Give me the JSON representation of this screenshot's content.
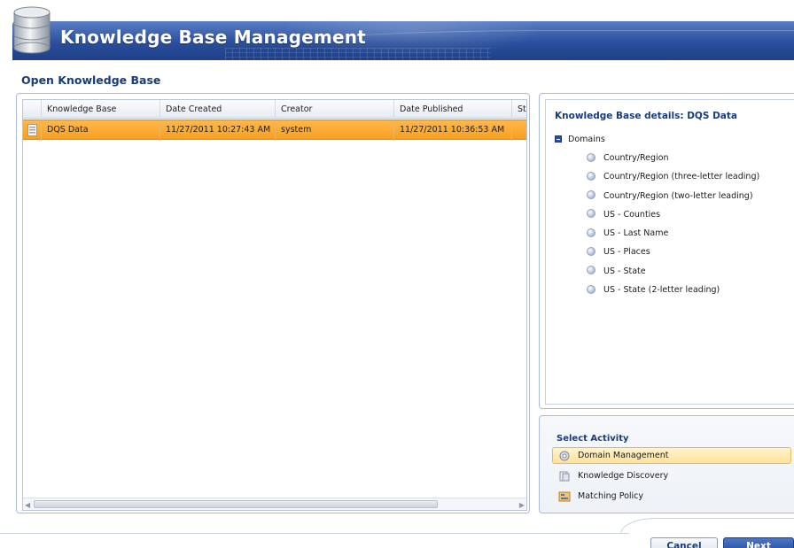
{
  "banner": {
    "title": "Knowledge Base Management"
  },
  "page": {
    "title": "Open Knowledge Base"
  },
  "grid": {
    "columns": [
      "Knowledge Base",
      "Date Created",
      "Creator",
      "Date Published",
      "Sta"
    ],
    "rows": [
      {
        "knowledge_base": "DQS Data",
        "date_created": "11/27/2011 10:27:43 AM",
        "creator": "system",
        "date_published": "11/27/2011 10:36:53 AM",
        "status": ""
      }
    ]
  },
  "details": {
    "title": "Knowledge Base details: DQS Data",
    "root_label": "Domains",
    "domains": [
      "Country/Region",
      "Country/Region (three-letter leading)",
      "Country/Region (two-letter leading)",
      "US - Counties",
      "US - Last Name",
      "US - Places",
      "US - State",
      "US - State (2-letter leading)"
    ]
  },
  "activity": {
    "title": "Select Activity",
    "items": [
      {
        "label": "Domain Management",
        "selected": true,
        "icon": "domain-management-icon"
      },
      {
        "label": "Knowledge Discovery",
        "selected": false,
        "icon": "knowledge-discovery-icon"
      },
      {
        "label": "Matching Policy",
        "selected": false,
        "icon": "matching-policy-icon"
      }
    ]
  },
  "footer": {
    "cancel_label": "Cancel",
    "next_label": "Next"
  },
  "colors": {
    "banner": "#2a4f9c",
    "selected_row": "#f6a021",
    "title_text": "#163c7d"
  }
}
